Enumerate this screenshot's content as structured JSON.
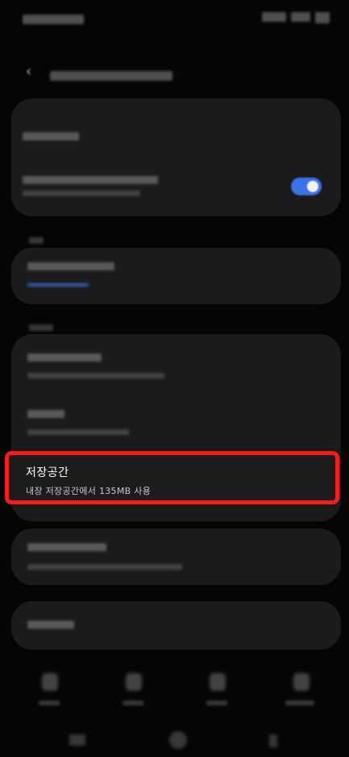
{
  "storage": {
    "title": "저장공간",
    "subtitle": "내장 저장공간에서 135MB 사용"
  },
  "colors": {
    "background": "#050505",
    "card": "#1b1b1d",
    "toggle_on": "#3a73e8",
    "highlight_border": "#ff1a1a"
  },
  "toggle": {
    "state": "on"
  },
  "icons": {
    "back": "arrow-left-icon",
    "tabs": [
      "home-icon",
      "apps-icon",
      "star-icon",
      "account-icon"
    ],
    "nav": [
      "recent-apps-icon",
      "home-button-icon",
      "back-button-icon"
    ]
  }
}
